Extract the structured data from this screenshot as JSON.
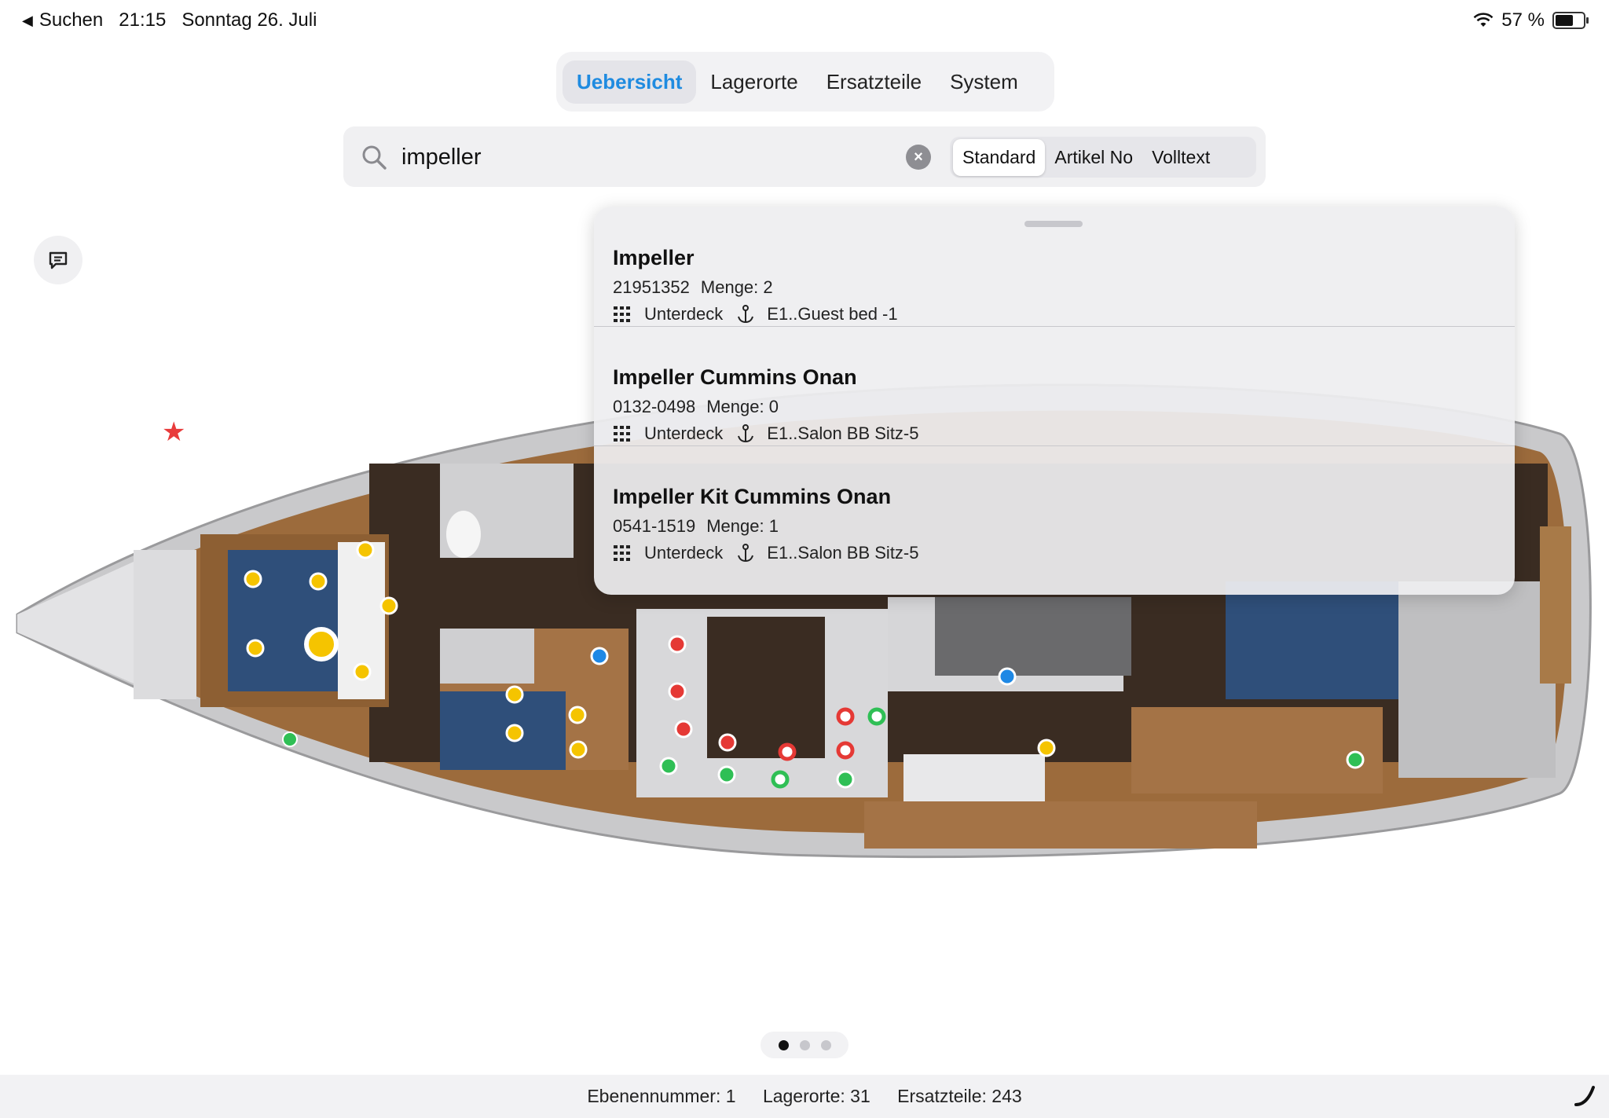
{
  "status_bar": {
    "back_label": "Suchen",
    "time": "21:15",
    "date": "Sonntag 26. Juli",
    "battery": "57 %",
    "battery_level": 0.57
  },
  "tabs": [
    {
      "label": "Uebersicht",
      "active": true
    },
    {
      "label": "Lagerorte",
      "active": false
    },
    {
      "label": "Ersatzteile",
      "active": false
    },
    {
      "label": "System",
      "active": false
    }
  ],
  "search": {
    "value": "impeller",
    "modes": [
      {
        "label": "Standard",
        "active": true
      },
      {
        "label": "Artikel No",
        "active": false
      },
      {
        "label": "Volltext",
        "active": false
      }
    ]
  },
  "results": [
    {
      "title": "Impeller",
      "article_no": "21951352",
      "quantity": "Menge: 2",
      "deck": "Unterdeck",
      "location": "E1..Guest bed -1"
    },
    {
      "title": "Impeller Cummins Onan",
      "article_no": "0132-0498",
      "quantity": "Menge: 0",
      "deck": "Unterdeck",
      "location": "E1..Salon BB Sitz-5"
    },
    {
      "title": "Impeller Kit Cummins Onan",
      "article_no": "0541-1519",
      "quantity": "Menge: 1",
      "deck": "Unterdeck",
      "location": "E1..Salon BB Sitz-5"
    }
  ],
  "map": {
    "marker_colors": {
      "yellow": "#f5c400",
      "red": "#e53935",
      "green": "#2fbf55",
      "blue": "#1e88e5"
    }
  },
  "pager": {
    "pages": 3,
    "current": 1
  },
  "footer": {
    "level": "Ebenennummer: 1",
    "locations": "Lagerorte: 31",
    "parts": "Ersatzteile: 243"
  },
  "icons": [
    "back-icon",
    "wifi-icon",
    "battery-icon",
    "search-icon",
    "clear-icon",
    "chat-icon",
    "grid-icon",
    "anchor-icon",
    "star-icon",
    "phone-icon"
  ]
}
